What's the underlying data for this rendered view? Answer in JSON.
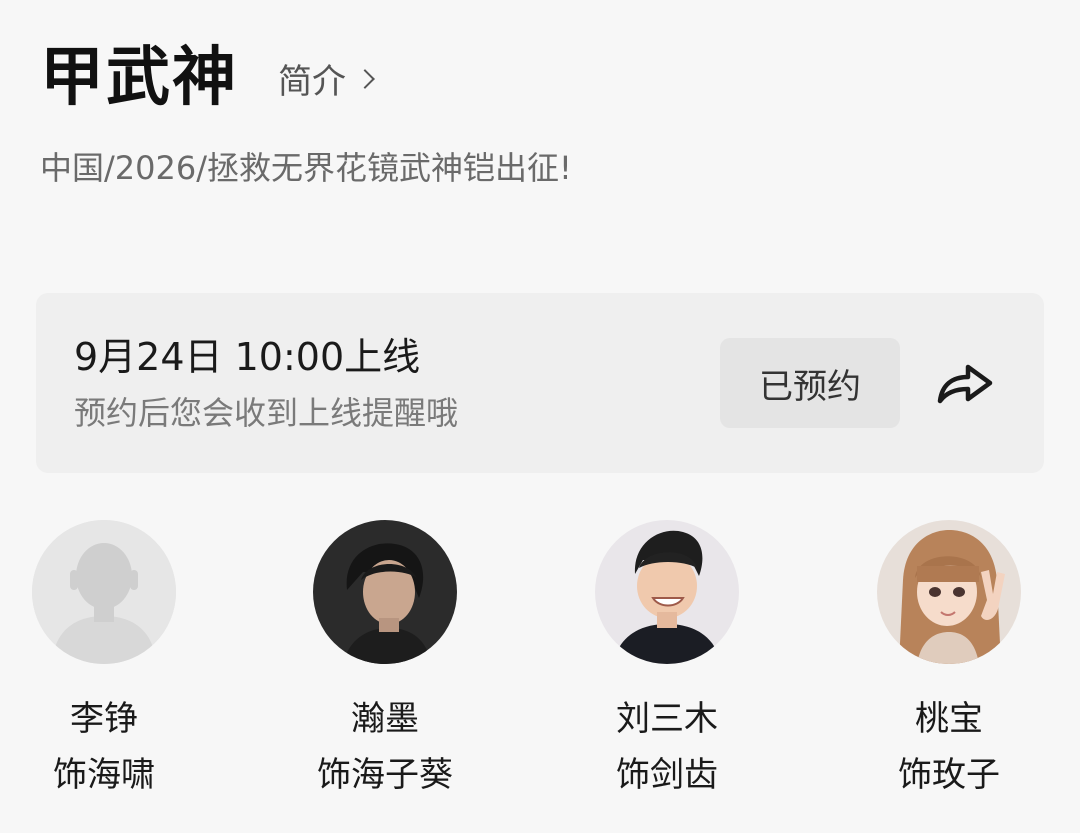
{
  "show": {
    "title": "甲武神",
    "intro_label": "简介",
    "meta": "中国/2026/拯救无界花镜武神铠出征!"
  },
  "reservation": {
    "release_time": "9月24日 10:00上线",
    "tip": "预约后您会收到上线提醒哦",
    "button_label": "已预约",
    "share_icon": "share-arrow-icon"
  },
  "cast": [
    {
      "actor": "李铮",
      "role": "饰海啸",
      "avatar": "placeholder-person"
    },
    {
      "actor": "瀚墨",
      "role": "饰海子葵",
      "avatar": "photo-dark-background"
    },
    {
      "actor": "刘三木",
      "role": "饰剑齿",
      "avatar": "photo-smiling-man"
    },
    {
      "actor": "桃宝",
      "role": "饰玫子",
      "avatar": "photo-girl-peace-sign"
    }
  ]
}
